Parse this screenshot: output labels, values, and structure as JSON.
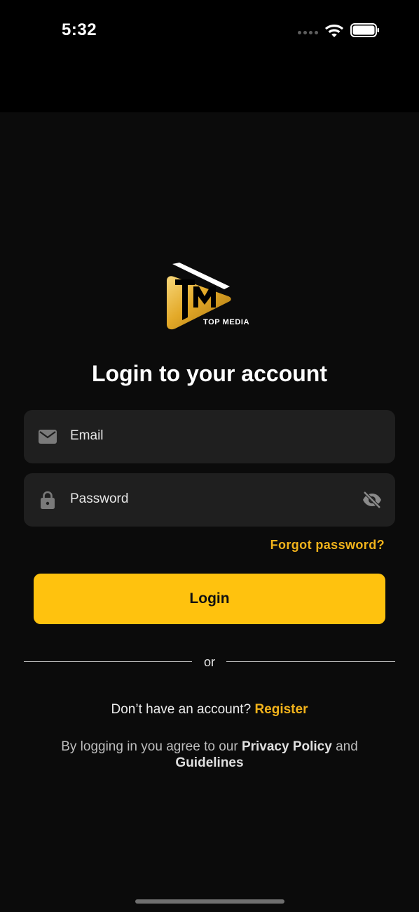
{
  "status_bar": {
    "time": "5:32"
  },
  "brand": {
    "logo_icon": "top-media-play-logo",
    "logo_caption": "TOP MEDIA",
    "accent_color": "#ffc20e",
    "link_color": "#f2b31b"
  },
  "login": {
    "title": "Login to your account",
    "email_placeholder": "Email",
    "password_placeholder": "Password",
    "forgot_password": "Forgot password?",
    "login_button": "Login",
    "divider_text": "or",
    "no_account_text": "Don’t have an account?",
    "register_link": "Register",
    "legal_prefix": "By logging in you agree to our",
    "privacy_policy": "Privacy Policy",
    "legal_and": "and",
    "guidelines": "Guidelines"
  }
}
